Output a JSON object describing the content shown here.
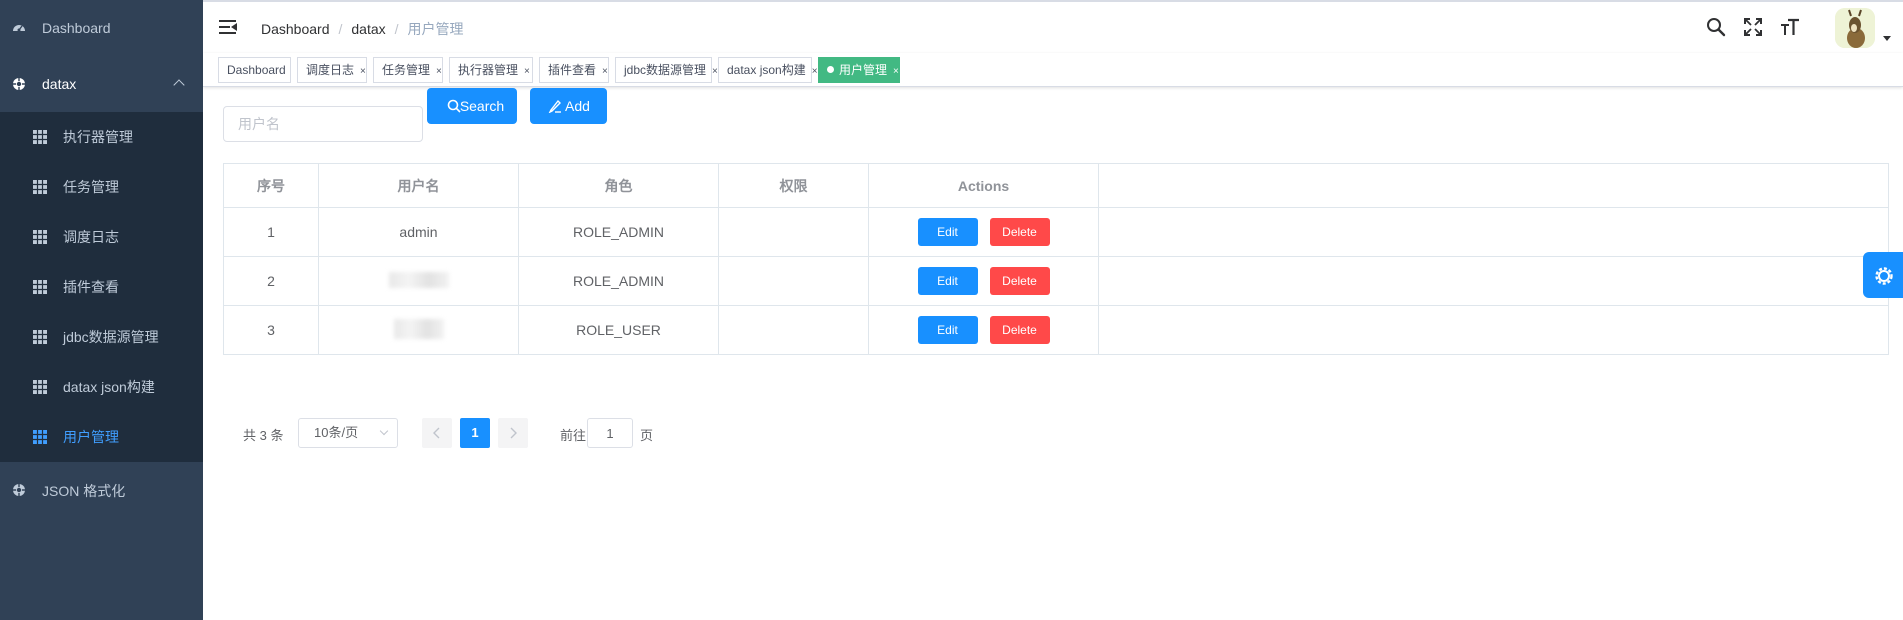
{
  "sidebar": {
    "dashboard": "Dashboard",
    "datax": "datax",
    "items": [
      {
        "label": "执行器管理"
      },
      {
        "label": "任务管理"
      },
      {
        "label": "调度日志"
      },
      {
        "label": "插件查看"
      },
      {
        "label": "jdbc数据源管理"
      },
      {
        "label": "datax json构建"
      },
      {
        "label": "用户管理"
      }
    ],
    "json_format": "JSON 格式化",
    "active_color": "#409EFF",
    "bg_color": "#304156"
  },
  "breadcrumb": [
    "Dashboard",
    "datax",
    "用户管理"
  ],
  "navbar_icons": [
    "search-icon",
    "fullscreen-icon",
    "text-size-icon",
    "avatar"
  ],
  "tags": [
    {
      "label": "Dashboard",
      "closable": false
    },
    {
      "label": "调度日志",
      "closable": true
    },
    {
      "label": "任务管理",
      "closable": true
    },
    {
      "label": "执行器管理",
      "closable": true
    },
    {
      "label": "插件查看",
      "closable": true
    },
    {
      "label": "jdbc数据源管理",
      "closable": true
    },
    {
      "label": "datax json构建",
      "closable": true
    },
    {
      "label": "用户管理",
      "closable": true,
      "active": true
    }
  ],
  "tag_close": "×",
  "toolbar": {
    "search_placeholder": "用户名",
    "search_label": "Search",
    "add_label": "Add"
  },
  "table": {
    "headers": [
      "序号",
      "用户名",
      "角色",
      "权限",
      "Actions"
    ],
    "rows": [
      {
        "index": "1",
        "username": "admin",
        "role": "ROLE_ADMIN",
        "permission": ""
      },
      {
        "index": "2",
        "username": "",
        "role": "ROLE_ADMIN",
        "permission": ""
      },
      {
        "index": "3",
        "username": "",
        "role": "ROLE_USER",
        "permission": ""
      }
    ],
    "edit_label": "Edit",
    "delete_label": "Delete"
  },
  "pagination": {
    "total": "共 3 条",
    "page_size": "10条/页",
    "current_page": "1",
    "goto_prefix": "前往",
    "goto_value": "1",
    "goto_suffix": "页"
  },
  "colors": {
    "primary": "#1890ff",
    "danger": "#ff4949",
    "tag_active": "#42b983"
  }
}
